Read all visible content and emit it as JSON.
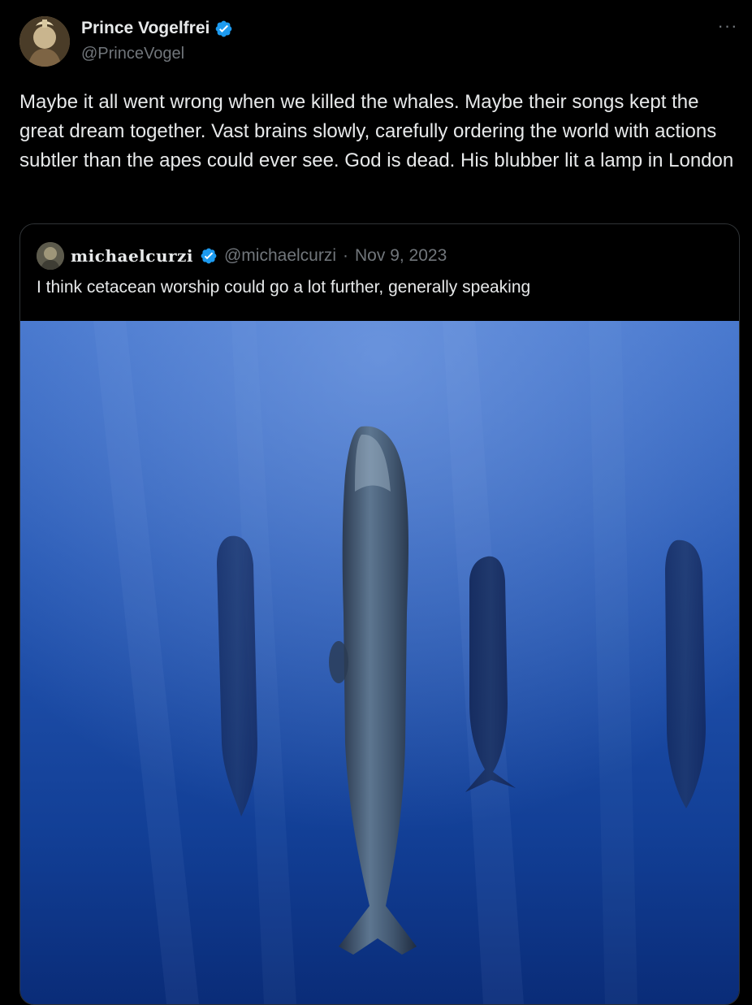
{
  "post": {
    "author_name": "Prince Vogelfrei",
    "author_handle": "@PrinceVogel",
    "more_icon": "more-horizontal-icon",
    "verified_icon": "verified-badge-icon",
    "text": "Maybe it all went wrong when we killed the whales. Maybe their songs kept the great dream together. Vast brains slowly, carefully ordering the world with actions subtler than the apes could ever see. God is dead. His blubber lit a lamp in London"
  },
  "quote": {
    "author_name": "michaelcurzi",
    "author_handle": "@michaelcurzi",
    "separator": "·",
    "date": "Nov 9, 2023",
    "text": "I think cetacean worship could go a lot further, generally speaking",
    "media": {
      "alt": "sperm whales sleeping vertically in blue water"
    }
  },
  "colors": {
    "background": "#000000",
    "text_primary": "#e7e9ea",
    "text_secondary": "#71767b",
    "verified_blue": "#1d9bf0",
    "border": "#2f3336"
  }
}
